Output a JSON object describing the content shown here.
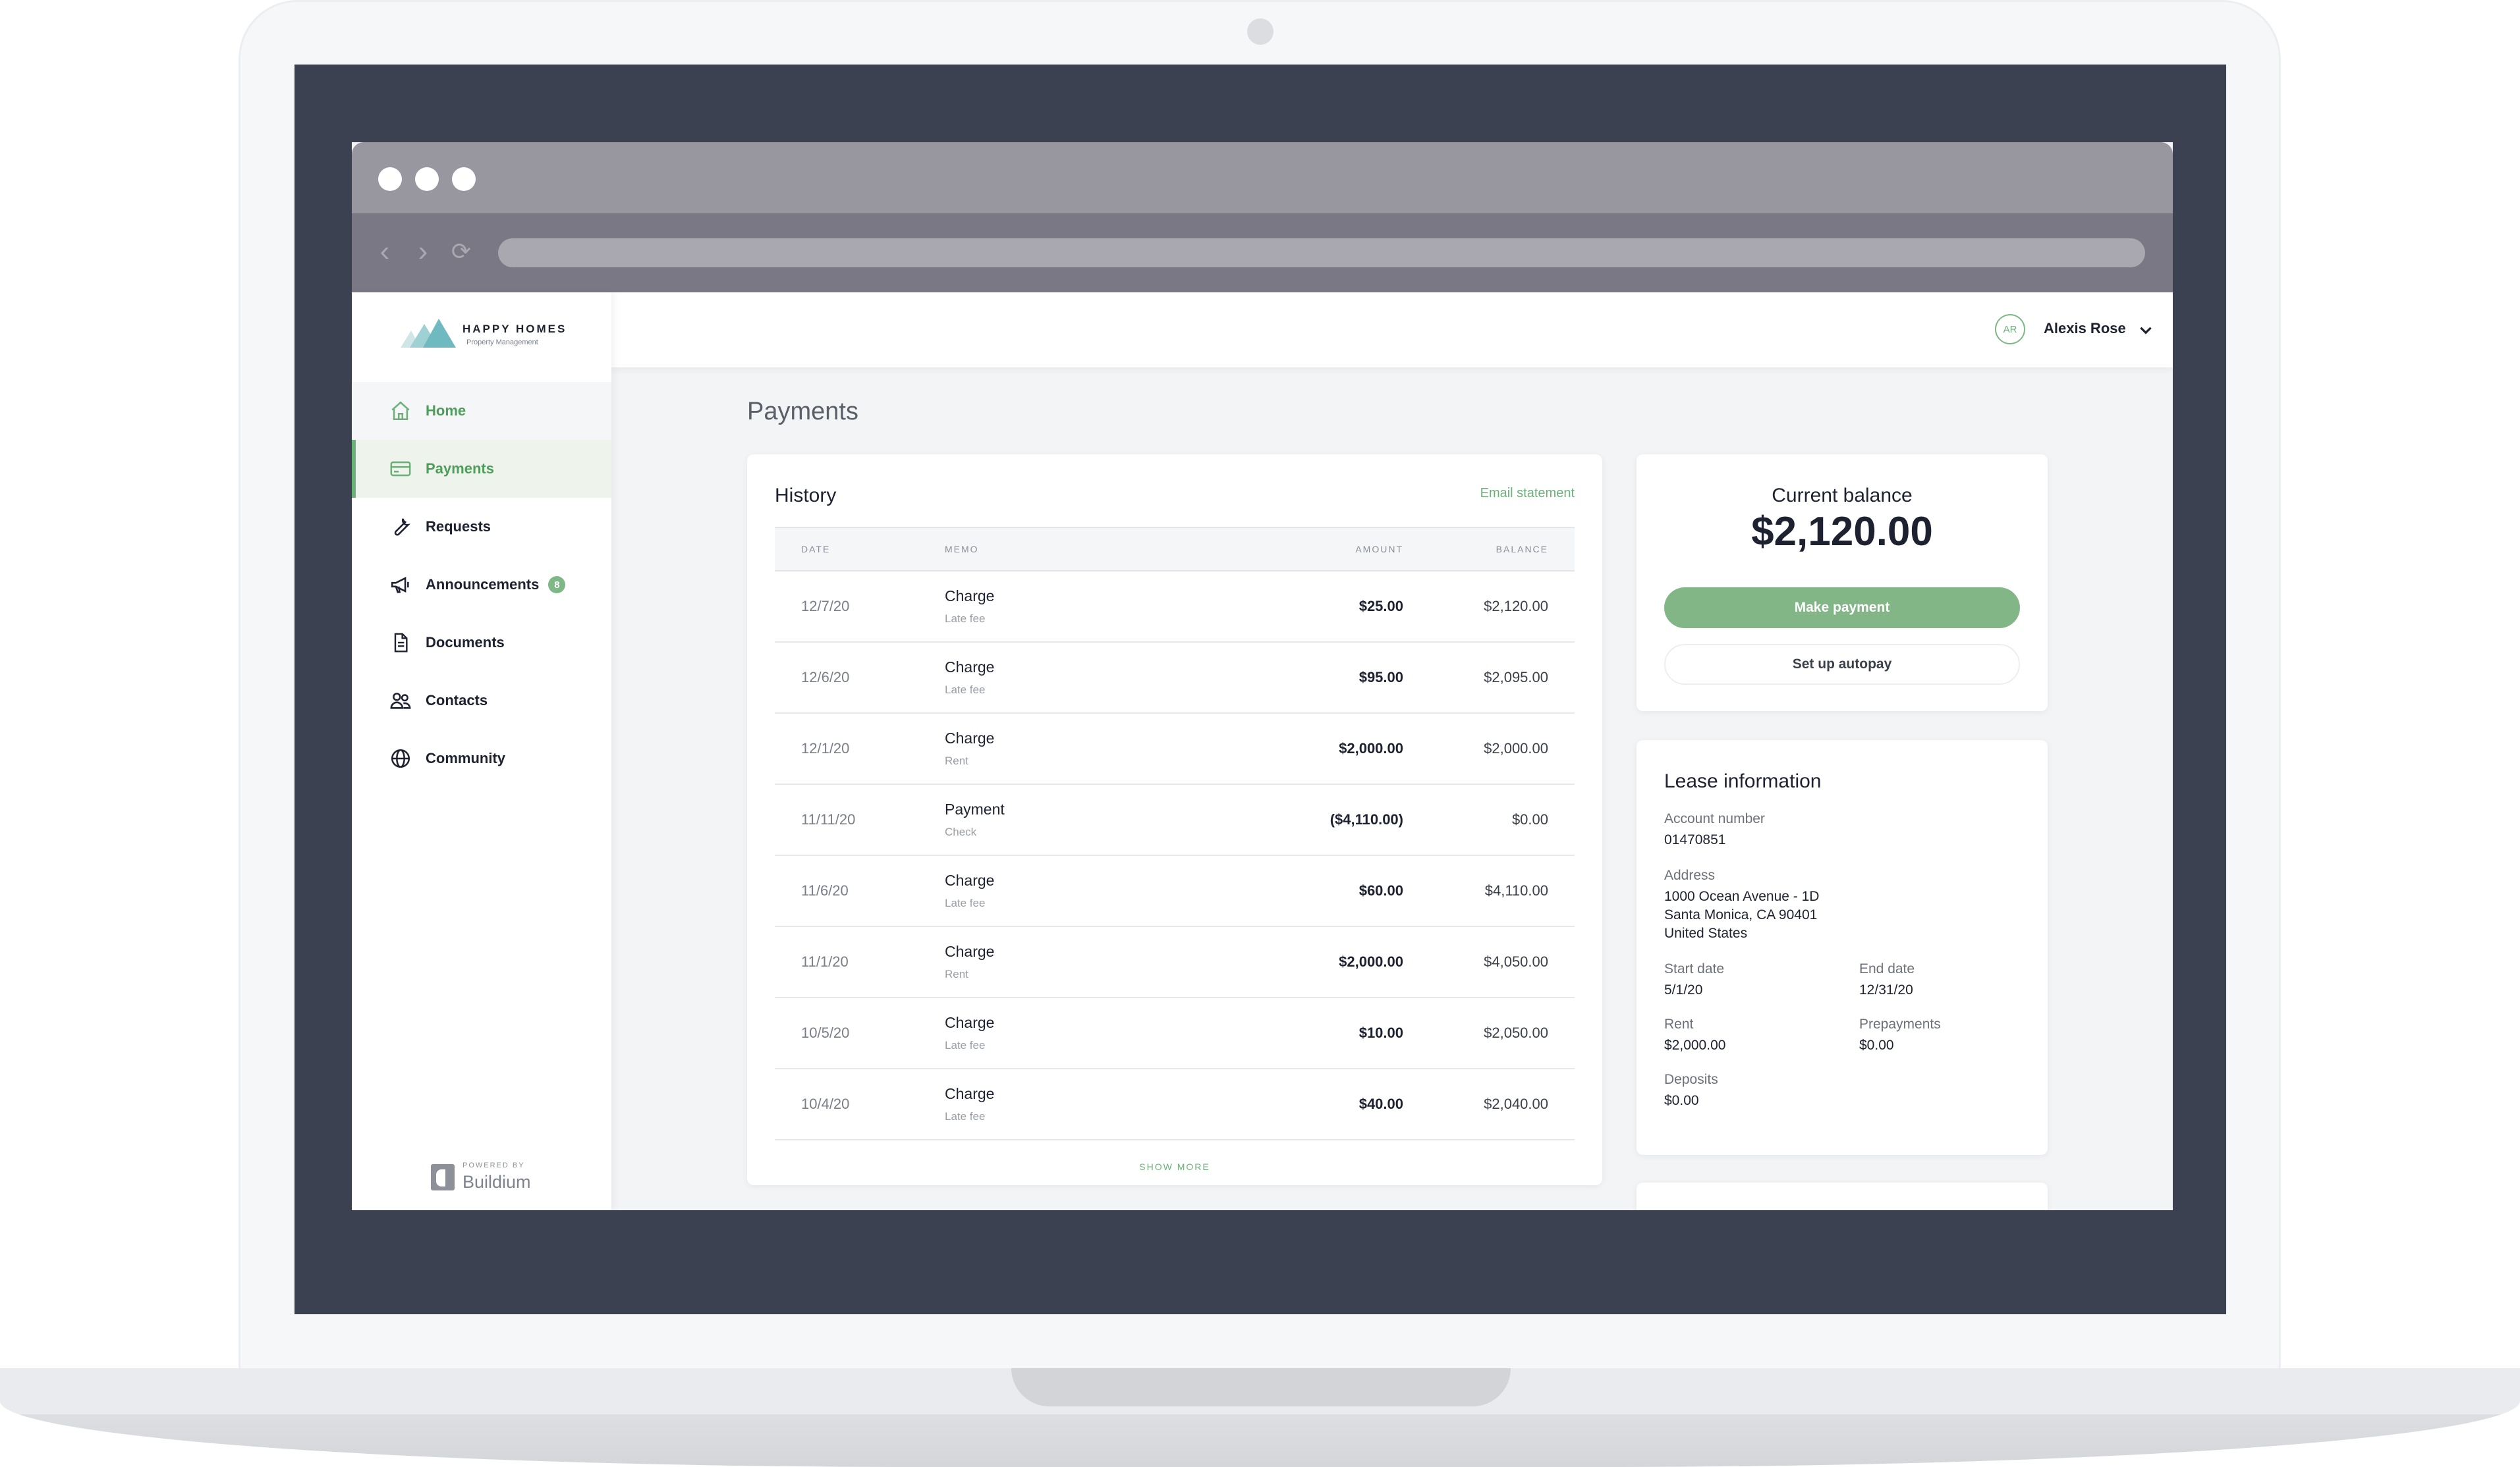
{
  "brand": {
    "name": "HAPPY HOMES",
    "tagline": "Property Management",
    "powered_by": "POWERED BY",
    "powered_brand": "Buildium"
  },
  "sidebar": {
    "items": [
      {
        "label": "Home",
        "icon": "home-icon"
      },
      {
        "label": "Payments",
        "icon": "credit-card-icon"
      },
      {
        "label": "Requests",
        "icon": "wrench-icon"
      },
      {
        "label": "Announcements",
        "icon": "megaphone-icon",
        "badge": "8"
      },
      {
        "label": "Documents",
        "icon": "document-icon"
      },
      {
        "label": "Contacts",
        "icon": "contacts-icon"
      },
      {
        "label": "Community",
        "icon": "globe-icon"
      }
    ]
  },
  "header": {
    "user_initials": "AR",
    "user_name": "Alexis Rose"
  },
  "page": {
    "title": "Payments"
  },
  "history": {
    "title": "History",
    "email_statement": "Email statement",
    "columns": [
      "DATE",
      "MEMO",
      "AMOUNT",
      "BALANCE"
    ],
    "rows": [
      {
        "date": "12/7/20",
        "memo": "Charge",
        "sub": "Late fee",
        "amount": "$25.00",
        "balance": "$2,120.00"
      },
      {
        "date": "12/6/20",
        "memo": "Charge",
        "sub": "Late fee",
        "amount": "$95.00",
        "balance": "$2,095.00"
      },
      {
        "date": "12/1/20",
        "memo": "Charge",
        "sub": "Rent",
        "amount": "$2,000.00",
        "balance": "$2,000.00"
      },
      {
        "date": "11/11/20",
        "memo": "Payment",
        "sub": "Check",
        "amount": "($4,110.00)",
        "balance": "$0.00"
      },
      {
        "date": "11/6/20",
        "memo": "Charge",
        "sub": "Late fee",
        "amount": "$60.00",
        "balance": "$4,110.00"
      },
      {
        "date": "11/1/20",
        "memo": "Charge",
        "sub": "Rent",
        "amount": "$2,000.00",
        "balance": "$4,050.00"
      },
      {
        "date": "10/5/20",
        "memo": "Charge",
        "sub": "Late fee",
        "amount": "$10.00",
        "balance": "$2,050.00"
      },
      {
        "date": "10/4/20",
        "memo": "Charge",
        "sub": "Late fee",
        "amount": "$40.00",
        "balance": "$2,040.00"
      }
    ],
    "show_more": "SHOW MORE"
  },
  "balance": {
    "label": "Current balance",
    "amount": "$2,120.00",
    "make_payment": "Make payment",
    "autopay": "Set up autopay"
  },
  "lease": {
    "title": "Lease information",
    "account_label": "Account number",
    "account_value": "01470851",
    "address_label": "Address",
    "address_lines": [
      "1000 Ocean Avenue - 1D",
      "Santa Monica, CA 90401",
      "United States"
    ],
    "start_label": "Start date",
    "start_value": "5/1/20",
    "end_label": "End date",
    "end_value": "12/31/20",
    "rent_label": "Rent",
    "rent_value": "$2,000.00",
    "prepay_label": "Prepayments",
    "prepay_value": "$0.00",
    "deposits_label": "Deposits",
    "deposits_value": "$0.00"
  },
  "colors": {
    "accent": "#6db07a",
    "primary_button": "#82b686",
    "laptop_bezel": "#3b4150"
  }
}
